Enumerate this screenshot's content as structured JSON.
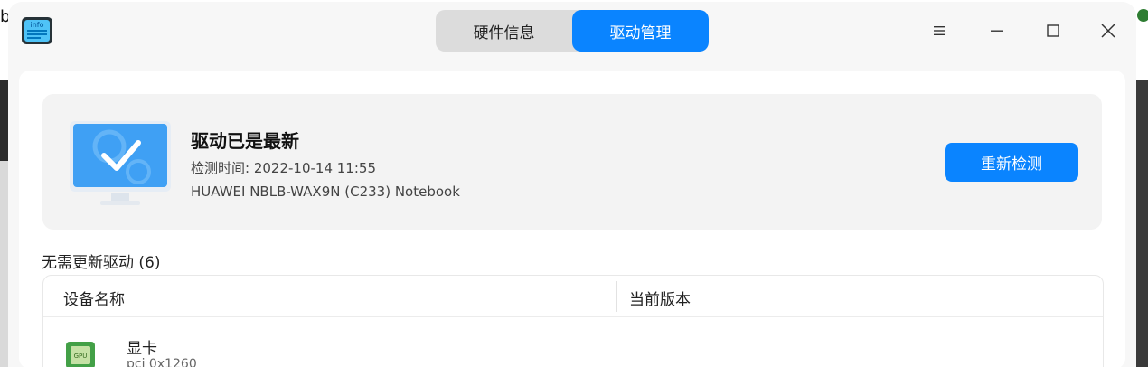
{
  "background": {
    "left_glyph": "b"
  },
  "titlebar": {
    "app_icon_text": "info",
    "tabs": [
      {
        "label": "硬件信息",
        "active": false
      },
      {
        "label": "驱动管理",
        "active": true
      }
    ],
    "accent_color": "#0a84ff"
  },
  "status": {
    "title": "驱动已是最新",
    "scan_time": "检测时间: 2022-10-14 11:55",
    "device_model": "HUAWEI NBLB-WAX9N (C233) Notebook",
    "rescan_label": "重新检测"
  },
  "drivers": {
    "section_title": "无需更新驱动 (6)",
    "columns": [
      "设备名称",
      "当前版本"
    ],
    "rows": [
      {
        "icon": "gpu-icon",
        "icon_text": "GPU",
        "name": "显卡",
        "id": "pci 0x1260"
      }
    ]
  }
}
